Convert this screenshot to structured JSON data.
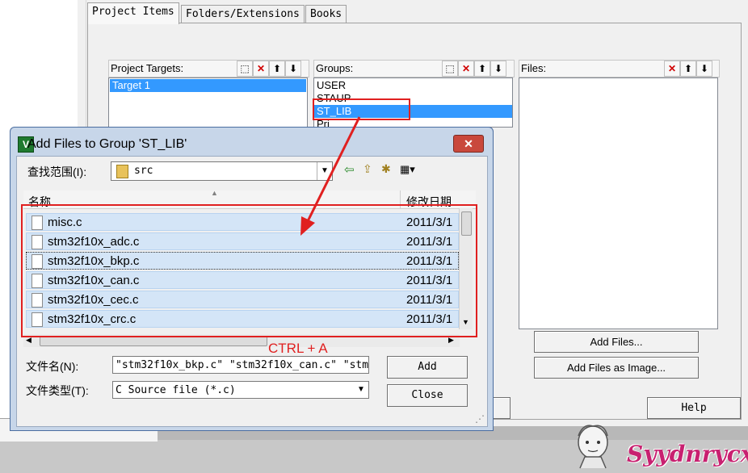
{
  "tabs": [
    "Project Items",
    "Folders/Extensions",
    "Books"
  ],
  "project_targets": {
    "label": "Project Targets:",
    "items": [
      "Target 1"
    ]
  },
  "groups": {
    "label": "Groups:",
    "items": [
      "USER",
      "STAUP",
      "ST_LIB",
      "Pri"
    ]
  },
  "files": {
    "label": "Files:"
  },
  "toolbar_icons": {
    "new": "new-icon",
    "delete": "delete-icon",
    "up": "move-up-icon",
    "down": "move-down-icon"
  },
  "buttons": {
    "add_files": "Add Files...",
    "add_files_image": "Add Files as Image...",
    "help": "Help"
  },
  "dialog": {
    "title": "Add Files to Group 'ST_LIB'",
    "close": "✕",
    "look_in_label": "查找范围(I):",
    "look_in_value": "src",
    "col_name": "名称",
    "col_date": "修改日期",
    "files": [
      {
        "name": "misc.c",
        "date": "2011/3/1"
      },
      {
        "name": "stm32f10x_adc.c",
        "date": "2011/3/1"
      },
      {
        "name": "stm32f10x_bkp.c",
        "date": "2011/3/1"
      },
      {
        "name": "stm32f10x_can.c",
        "date": "2011/3/1"
      },
      {
        "name": "stm32f10x_cec.c",
        "date": "2011/3/1"
      },
      {
        "name": "stm32f10x_crc.c",
        "date": "2011/3/1"
      }
    ],
    "filename_label": "文件名(N):",
    "filename_value": "\"stm32f10x_bkp.c\" \"stm32f10x_can.c\" \"stm",
    "filetype_label": "文件类型(T):",
    "filetype_value": "C Source file (*.c)",
    "add": "Add",
    "close_btn": "Close"
  },
  "annotation": "CTRL + A",
  "watermark": "Syydnrycx",
  "colors": {
    "selection": "#3399ff",
    "annotation": "#e02020",
    "file_row": "#d4e5f7"
  }
}
